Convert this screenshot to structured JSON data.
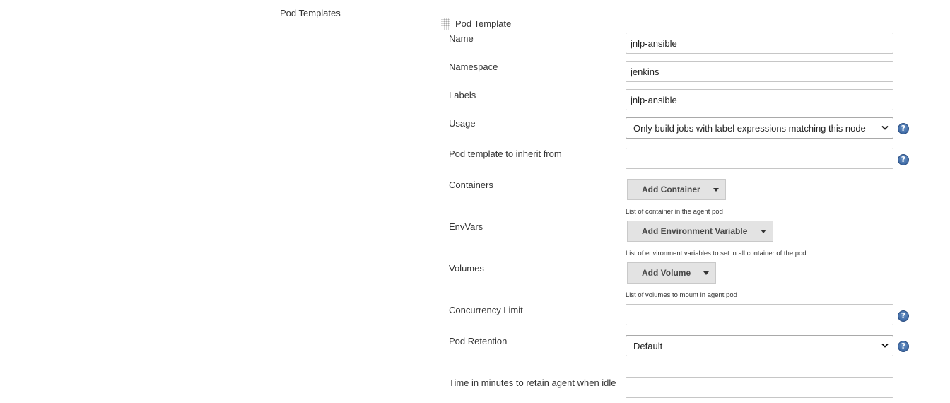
{
  "section": {
    "label": "Pod Templates"
  },
  "pod_template": {
    "title": "Pod Template",
    "fields": {
      "name": {
        "label": "Name",
        "value": "jnlp-ansible"
      },
      "namespace": {
        "label": "Namespace",
        "value": "jenkins"
      },
      "labels": {
        "label": "Labels",
        "value": "jnlp-ansible"
      },
      "usage": {
        "label": "Usage",
        "selected": "Only build jobs with label expressions matching this node"
      },
      "inherit_from": {
        "label": "Pod template to inherit from",
        "value": ""
      },
      "containers": {
        "label": "Containers",
        "button": "Add Container",
        "hint": "List of container in the agent pod"
      },
      "envvars": {
        "label": "EnvVars",
        "button": "Add Environment Variable",
        "hint": "List of environment variables to set in all container of the pod"
      },
      "volumes": {
        "label": "Volumes",
        "button": "Add Volume",
        "hint": "List of volumes to mount in agent pod"
      },
      "concurrency_limit": {
        "label": "Concurrency Limit",
        "value": ""
      },
      "pod_retention": {
        "label": "Pod Retention",
        "selected": "Default"
      },
      "idle_minutes": {
        "label": "Time in minutes to retain agent when idle",
        "value": ""
      }
    }
  },
  "icons": {
    "help": "help-icon",
    "help_glyph": "?",
    "drag": "drag-handle-icon",
    "dropdown": "chevron-down-icon",
    "menu_caret": "caret-down-icon"
  },
  "colors": {
    "help_icon": "#3f6aa5",
    "menu_button_bg": "#e3e3e3",
    "input_border": "#c6c6c6"
  }
}
